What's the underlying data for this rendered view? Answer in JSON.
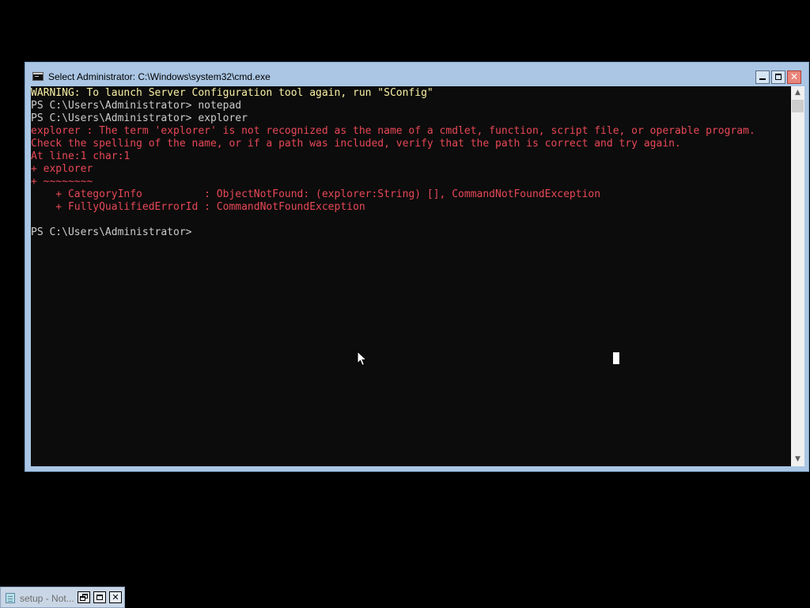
{
  "window": {
    "title": "Select Administrator: C:\\Windows\\system32\\cmd.exe",
    "icon": "console-icon"
  },
  "console": {
    "lines": [
      {
        "text": "WARNING: To launch Server Configuration tool again, run \"SConfig\"",
        "kind": "warning"
      },
      {
        "text": "PS C:\\Users\\Administrator> notepad",
        "kind": "normal"
      },
      {
        "text": "PS C:\\Users\\Administrator> explorer",
        "kind": "normal"
      },
      {
        "text": "explorer : The term 'explorer' is not recognized as the name of a cmdlet, function, script file, or operable program.",
        "kind": "error"
      },
      {
        "text": "Check the spelling of the name, or if a path was included, verify that the path is correct and try again.",
        "kind": "error"
      },
      {
        "text": "At line:1 char:1",
        "kind": "error"
      },
      {
        "text": "+ explorer",
        "kind": "error"
      },
      {
        "text": "+ ~~~~~~~~",
        "kind": "error"
      },
      {
        "text": "    + CategoryInfo          : ObjectNotFound: (explorer:String) [], CommandNotFoundException",
        "kind": "error"
      },
      {
        "text": "    + FullyQualifiedErrorId : CommandNotFoundException",
        "kind": "error"
      },
      {
        "text": "",
        "kind": "normal"
      },
      {
        "text": "PS C:\\Users\\Administrator>",
        "kind": "normal"
      }
    ],
    "colors": {
      "background": "#0c0c0c",
      "normal": "#cccccc",
      "warning": "#f9f1a5",
      "error": "#e74856"
    }
  },
  "taskbar_item": {
    "label": "setup - Not...",
    "icon": "notepad-icon"
  },
  "icons": {
    "minimize": "minimize-icon",
    "maximize": "maximize-icon",
    "close": "close-icon",
    "restore": "restore-icon",
    "scroll_up": "scroll-up-arrow-icon",
    "scroll_down": "scroll-down-arrow-icon",
    "pointer": "mouse-pointer-icon"
  }
}
